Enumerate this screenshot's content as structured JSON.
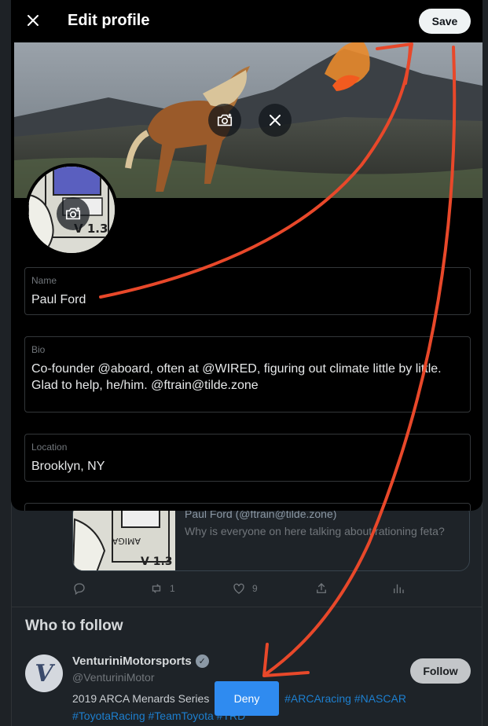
{
  "modal": {
    "title": "Edit profile",
    "save_label": "Save",
    "fields": {
      "name": {
        "label": "Name",
        "value": "Paul Ford"
      },
      "bio": {
        "label": "Bio",
        "value": "Co-founder @aboard, often at @WIRED, figuring out climate little by little. Glad to help, he/him. @ftrain@tilde.zone"
      },
      "location": {
        "label": "Location",
        "value": "Brooklyn, NY"
      }
    }
  },
  "feed": {
    "quote": {
      "author": "Paul Ford (@ftrain@tilde.zone)",
      "text": "Why is everyone on here talking about rationing feta?"
    },
    "actions": {
      "replies": "",
      "retweets": "1",
      "likes": "9"
    }
  },
  "who_to_follow": {
    "title": "Who to follow",
    "account": {
      "name": "VenturiniMotorsports",
      "handle": "@VenturiniMotor",
      "bio_prefix": "2019 ARCA Menards Series",
      "bio_tags_line1": "#ARCAracing #NASCAR",
      "bio_tags_line2": "#ToyotaRacing #TeamToyota #TRD",
      "avatar_letter": "V",
      "follow_label": "Follow"
    }
  },
  "deny_label": "Deny",
  "colors": {
    "accent": "#1d9bf0",
    "arrow": "#e8482a",
    "deny": "#2f8bf0"
  }
}
